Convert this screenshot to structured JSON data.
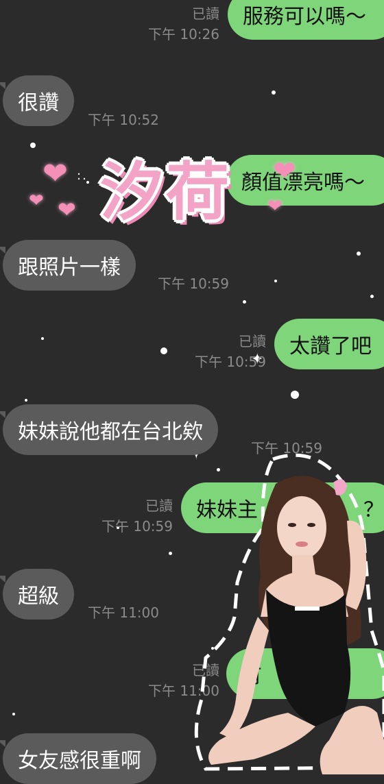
{
  "messages": [
    {
      "text": "服務可以嗎～",
      "dir": "out",
      "read": "已讀",
      "time": "下午 10:26"
    },
    {
      "text": "很讚",
      "dir": "in",
      "time": "下午 10:52"
    },
    {
      "text": "顏值漂亮嗎～",
      "dir": "out"
    },
    {
      "text": "跟照片一樣",
      "dir": "in",
      "time": "下午 10:59"
    },
    {
      "text": "太讚了吧",
      "dir": "out",
      "read": "已讀",
      "time": "下午 10:59"
    },
    {
      "text": "妹妹說他都在台北欸",
      "dir": "in",
      "time": "下午 10:59"
    },
    {
      "text": "妹妹主",
      "text_tail": "？",
      "dir": "out",
      "read": "已讀",
      "time": "下午 10:59"
    },
    {
      "text": "超級",
      "dir": "in",
      "time": "下午 11:00"
    },
    {
      "text": "有",
      "dir": "out",
      "read": "已讀",
      "time": "下午 11:00"
    },
    {
      "text": "女友感很重啊",
      "dir": "in"
    }
  ],
  "overlay": {
    "logo_text": "汐荷",
    "heart_icon": "heart",
    "sparkle_icon": "sparkle-icon"
  },
  "colors": {
    "background": "#2b2b2b",
    "incoming_bubble": "#5b5b5b",
    "outgoing_bubble": "#7ed57a",
    "logo_pink": "#f3a4c6",
    "meta_gray": "#8b8b8b"
  }
}
